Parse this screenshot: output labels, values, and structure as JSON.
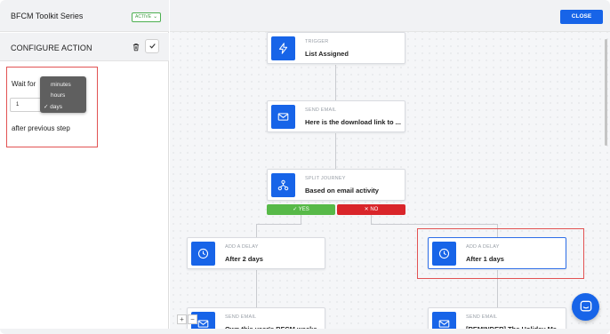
{
  "sidebar": {
    "series_title": "BFCM Toolkit Series",
    "status_badge": "ACTIVE",
    "config_title": "CONFIGURE ACTION"
  },
  "delay_form": {
    "wait_for_label": "Wait for",
    "quantity_value": "1",
    "unit_options": [
      "minutes",
      "hours",
      "days"
    ],
    "selected_unit": "days",
    "selected_mark": "✓",
    "after_label": "after previous step"
  },
  "toolbar": {
    "close_label": "CLOSE"
  },
  "flow": {
    "nodes": [
      {
        "kind": "TRIGGER",
        "name": "List Assigned",
        "icon": "bolt-icon"
      },
      {
        "kind": "SEND EMAIL",
        "name": "Here is the download link to ...",
        "icon": "mail-icon"
      },
      {
        "kind": "SPLIT JOURNEY",
        "name": "Based on email activity",
        "icon": "split-icon"
      },
      {
        "kind": "ADD A DELAY",
        "name": "After 2 days",
        "icon": "clock-icon"
      },
      {
        "kind": "ADD A DELAY",
        "name": "After 1 days",
        "icon": "clock-icon"
      },
      {
        "kind": "SEND EMAIL",
        "name": "Own this year's BFCM weeke",
        "icon": "mail-icon"
      },
      {
        "kind": "SEND EMAIL",
        "name": "[REMINDER] The Holiday Ma",
        "icon": "mail-icon"
      }
    ],
    "yes_label": "✓ YES",
    "no_label": "✕ NO"
  },
  "zoom": {
    "plus": "+",
    "minus": "−"
  },
  "colors": {
    "accent": "#1764e8",
    "yes": "#57b948",
    "no": "#d9252a",
    "highlight_box": "#e25353",
    "active_badge": "#4caf50"
  }
}
